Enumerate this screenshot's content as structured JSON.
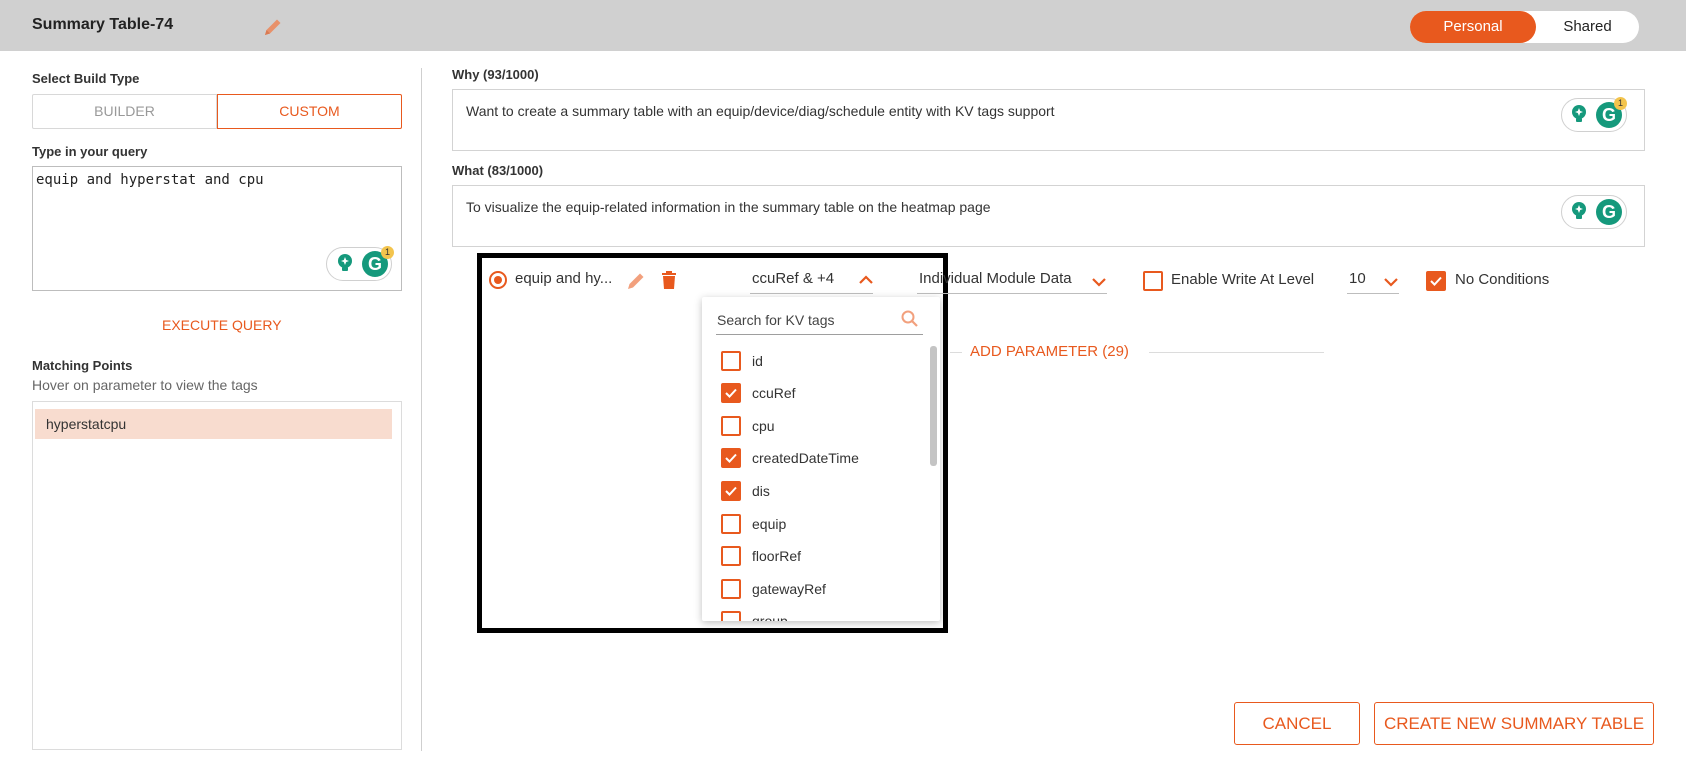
{
  "header": {
    "title": "Summary Table-74",
    "toggle": {
      "on": "Personal",
      "off": "Shared"
    }
  },
  "left": {
    "build_type_label": "Select Build Type",
    "build_types": {
      "builder": "BUILDER",
      "custom": "CUSTOM",
      "selected": "CUSTOM"
    },
    "query_label": "Type in your query",
    "query_value": "equip and hyperstat and cpu",
    "grammarly_badge": "1",
    "execute_label": "EXECUTE QUERY",
    "matching_title": "Matching Points",
    "matching_subtitle": "Hover on parameter to view the tags",
    "matching_items": [
      "hyperstatcpu"
    ]
  },
  "right": {
    "why_label": "Why (93/1000)",
    "why_value": "Want to create a summary table with an equip/device/diag/schedule entity with KV tags support",
    "why_badge": "1",
    "what_label": "What (83/1000)",
    "what_value": "To visualize the equip-related information in the summary table on the heatmap page",
    "param": {
      "name": "equip and hy...",
      "kv_selection": "ccuRef & +4",
      "module_selection": "Individual Module Data",
      "enable_write_label": "Enable Write At Level",
      "enable_write_checked": false,
      "level_value": "10",
      "no_conditions_label": "No Conditions",
      "no_conditions_checked": true
    },
    "add_parameter": "ADD PARAMETER (29)",
    "kv_dropdown": {
      "search_placeholder": "Search for KV tags",
      "options": [
        {
          "label": "id",
          "checked": false
        },
        {
          "label": "ccuRef",
          "checked": true
        },
        {
          "label": "cpu",
          "checked": false
        },
        {
          "label": "createdDateTime",
          "checked": true
        },
        {
          "label": "dis",
          "checked": true
        },
        {
          "label": "equip",
          "checked": false
        },
        {
          "label": "floorRef",
          "checked": false
        },
        {
          "label": "gatewayRef",
          "checked": false
        },
        {
          "label": "group",
          "checked": false
        }
      ]
    }
  },
  "footer": {
    "cancel": "CANCEL",
    "create": "CREATE NEW SUMMARY TABLE"
  },
  "colors": {
    "accent": "#e8591e",
    "header_bg": "#d0d0d0",
    "highlight": "#f8dccf",
    "grammarly": "#15997c"
  }
}
